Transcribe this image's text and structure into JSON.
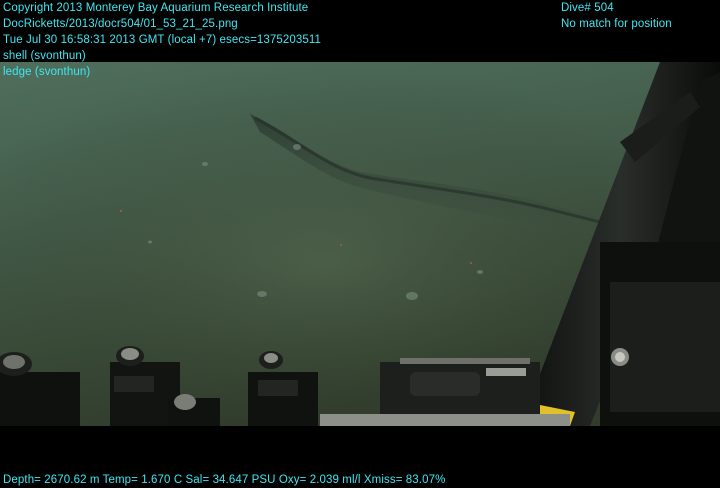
{
  "overlay": {
    "copyright": "Copyright 2013 Monterey Bay Aquarium Research Institute",
    "filename": "DocRicketts/2013/docr504/01_53_21_25.png",
    "timestamp": "Tue Jul 30 16:58:31 2013 GMT (local +7)  esecs=1375203511",
    "annotation_1": "shell (svonthun)",
    "annotation_2": "ledge (svonthun)",
    "dive": "Dive# 504",
    "position_status": "No match for position",
    "telemetry": "Depth= 2670.62 m  Temp= 1.670 C  Sal= 34.647 PSU  Oxy= 2.039 ml/l  Xmiss= 83.07%"
  },
  "colors": {
    "overlay_text": "#3fe7f2",
    "seafloor": "#3d4a33",
    "water": "#4a6a55"
  },
  "scene": {
    "subject": "deep-sea seafloor with sediment ledge and ROV sampling equipment"
  }
}
